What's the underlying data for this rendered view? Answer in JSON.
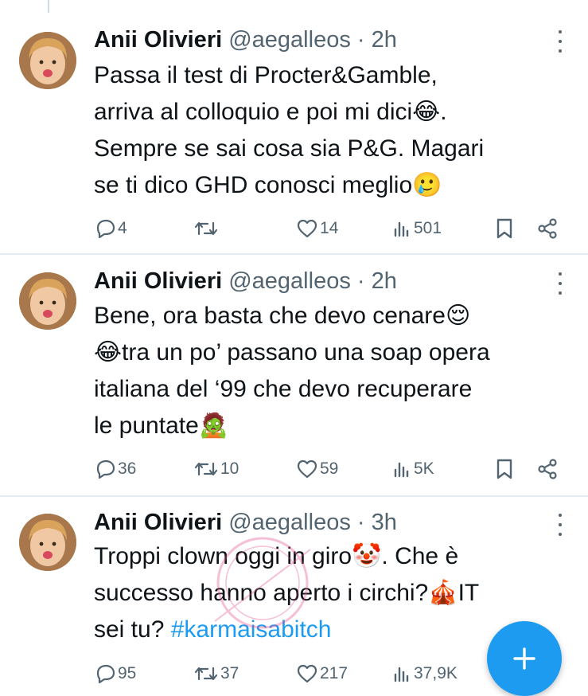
{
  "tweets": [
    {
      "name": "Anii Olivieri",
      "handle": "@aegalleos",
      "separator": "·",
      "time": "2h",
      "lines": [
        "Passa il test di Procter&Gamble,",
        "arriva al colloquio e poi mi dici😂.",
        "Sempre se sai cosa sia P&G. Magari",
        "se ti dico GHD conosci meglio🥲"
      ],
      "replies": "4",
      "retweets": "",
      "likes": "14",
      "views": "501"
    },
    {
      "name": "Anii Olivieri",
      "handle": "@aegalleos",
      "separator": "·",
      "time": "2h",
      "lines": [
        "Bene, ora basta che devo cenare😌",
        "😂tra un po’ passano una soap opera",
        "italiana del ‘99 che devo recuperare",
        "le puntate🧟"
      ],
      "replies": "36",
      "retweets": "10",
      "likes": "59",
      "views": "5K"
    },
    {
      "name": "Anii Olivieri",
      "handle": "@aegalleos",
      "separator": "·",
      "time": "3h",
      "lines": [
        "Troppi clown oggi in giro🤡. Che è",
        "successo hanno aperto i circhi?🎪IT",
        "sei tu? "
      ],
      "hashtag": "#karmaisabitch",
      "replies": "95",
      "retweets": "37",
      "likes": "217",
      "views": "37,9K"
    }
  ],
  "icons": {
    "reply": "reply-icon",
    "retweet": "retweet-icon",
    "like": "heart-icon",
    "views": "views-icon",
    "bookmark": "bookmark-icon",
    "share": "share-icon",
    "more": "more-icon",
    "compose": "plus-icon"
  },
  "colors": {
    "accent": "#1d9bf0",
    "text": "#0f1419",
    "secondary": "#536471",
    "divider": "#e6ecf0"
  }
}
